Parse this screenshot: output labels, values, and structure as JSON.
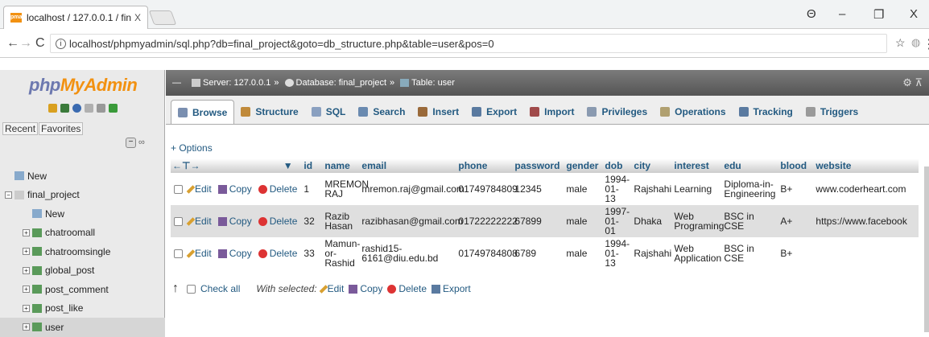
{
  "browser": {
    "tab_title": "localhost / 127.0.0.1 / fin",
    "tab_close": "X",
    "url": "localhost/phpmyadmin/sql.php?db=final_project&goto=db_structure.php&table=user&pos=0",
    "win_minimize": "–",
    "win_restore": "❐",
    "win_close": "X",
    "account_icon": "Θ"
  },
  "sidebar": {
    "logo_php": "php",
    "logo_myadmin": "MyAdmin",
    "recent_label": "Recent",
    "favorites_label": "Favorites",
    "tree": [
      {
        "label": "New",
        "indent": 0,
        "icon": "new-icon"
      },
      {
        "label": "final_project",
        "indent": 0,
        "icon": "database-icon"
      },
      {
        "label": "New",
        "indent": 1,
        "icon": "new-icon"
      },
      {
        "label": "chatroomall",
        "indent": 1,
        "icon": "table-icon"
      },
      {
        "label": "chatroomsingle",
        "indent": 1,
        "icon": "table-icon"
      },
      {
        "label": "global_post",
        "indent": 1,
        "icon": "table-icon"
      },
      {
        "label": "post_comment",
        "indent": 1,
        "icon": "table-icon"
      },
      {
        "label": "post_like",
        "indent": 1,
        "icon": "table-icon"
      },
      {
        "label": "user",
        "indent": 1,
        "icon": "table-icon",
        "selected": true
      }
    ]
  },
  "breadcrumb": {
    "server": "Server: 127.0.0.1",
    "sep1": "»",
    "database": "Database: final_project",
    "sep2": "»",
    "table": "Table: user"
  },
  "menu": [
    {
      "label": "Browse",
      "icon": "browse-icon",
      "color": "#7a8fb0",
      "active": true
    },
    {
      "label": "Structure",
      "icon": "structure-icon",
      "color": "#c08a3a"
    },
    {
      "label": "SQL",
      "icon": "sql-icon",
      "color": "#8aa0c0"
    },
    {
      "label": "Search",
      "icon": "search-icon",
      "color": "#6a8ab0"
    },
    {
      "label": "Insert",
      "icon": "insert-icon",
      "color": "#9a6a3a"
    },
    {
      "label": "Export",
      "icon": "export-icon",
      "color": "#5a7aa0"
    },
    {
      "label": "Import",
      "icon": "import-icon",
      "color": "#a04a4a"
    },
    {
      "label": "Privileges",
      "icon": "privileges-icon",
      "color": "#8a9ab0"
    },
    {
      "label": "Operations",
      "icon": "operations-icon",
      "color": "#b0a070"
    },
    {
      "label": "Tracking",
      "icon": "tracking-icon",
      "color": "#5a7aa0"
    },
    {
      "label": "Triggers",
      "icon": "triggers-icon",
      "color": "#9a9a9a"
    }
  ],
  "options_label": "+ Options",
  "columns": [
    "id",
    "name",
    "email",
    "phone",
    "password",
    "gender",
    "dob",
    "city",
    "interest",
    "edu",
    "blood",
    "website"
  ],
  "actions": {
    "edit": "Edit",
    "copy": "Copy",
    "delete": "Delete"
  },
  "rows": [
    {
      "id": "1",
      "name": "MREMON RAJ",
      "email": "mremon.raj@gmail.com",
      "phone": "01749784809",
      "password": "12345",
      "gender": "male",
      "dob": "1994-01-13",
      "city": "Rajshahi",
      "interest": "Learning",
      "edu": "Diploma-in-Engineering",
      "blood": "B+",
      "website": "www.coderheart.com"
    },
    {
      "id": "32",
      "name": "Razib Hasan",
      "email": "razibhasan@gmail.com",
      "phone": "01722222222",
      "password": "67899",
      "gender": "male",
      "dob": "1997-01-01",
      "city": "Dhaka",
      "interest": "Web Programing",
      "edu": "BSC in CSE",
      "blood": "A+",
      "website": "https://www.facebook"
    },
    {
      "id": "33",
      "name": "Mamun-or-Rashid",
      "email": "rashid15-6161@diu.edu.bd",
      "phone": "01749784808",
      "password": "6789",
      "gender": "male",
      "dob": "1994-01-13",
      "city": "Rajshahi",
      "interest": "Web Application",
      "edu": "BSC in CSE",
      "blood": "B+",
      "website": ""
    }
  ],
  "bottom": {
    "check_all": "Check all",
    "with_selected": "With selected:",
    "edit": "Edit",
    "copy": "Copy",
    "delete": "Delete",
    "export": "Export"
  }
}
